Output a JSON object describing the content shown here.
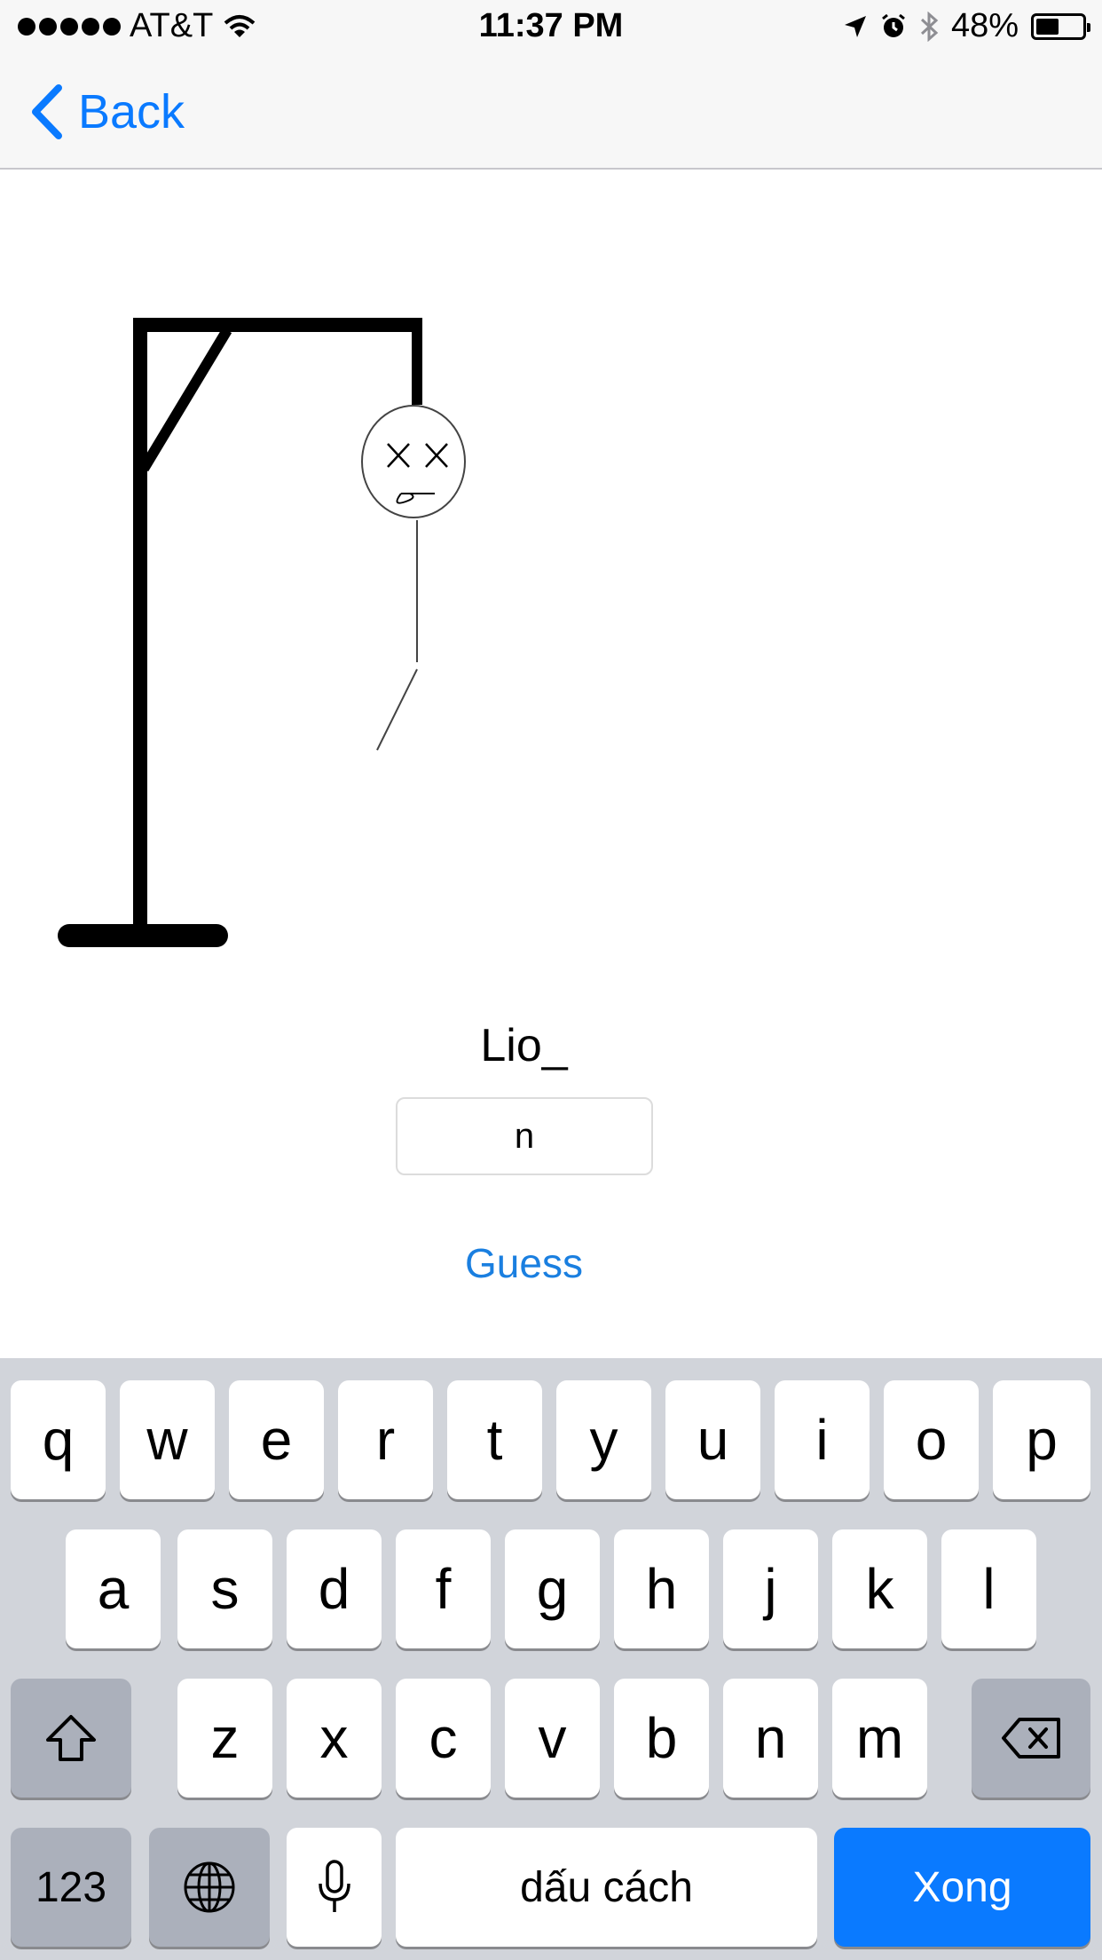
{
  "status_bar": {
    "carrier": "AT&T",
    "time": "11:37 PM",
    "battery": "48%",
    "battery_level": 0.48,
    "icons": [
      "signal-dots-icon",
      "wifi-icon",
      "location-icon",
      "alarm-icon",
      "bluetooth-icon",
      "battery-icon"
    ]
  },
  "nav": {
    "back_label": "Back",
    "back_icon": "chevron-left-icon",
    "accent_color": "#0a7aff"
  },
  "game": {
    "word": "Lio_",
    "guess_value": "n",
    "guess_button_label": "Guess"
  },
  "keyboard": {
    "row1": [
      "q",
      "w",
      "e",
      "r",
      "t",
      "y",
      "u",
      "i",
      "o",
      "p"
    ],
    "row2": [
      "a",
      "s",
      "d",
      "f",
      "g",
      "h",
      "j",
      "k",
      "l"
    ],
    "row3": [
      "z",
      "x",
      "c",
      "v",
      "b",
      "n",
      "m"
    ],
    "numbers_label": "123",
    "space_label": "dấu cách",
    "done_label": "Xong",
    "icons": [
      "shift-icon",
      "backspace-icon",
      "globe-icon",
      "microphone-icon"
    ],
    "done_color": "#0a7aff"
  }
}
